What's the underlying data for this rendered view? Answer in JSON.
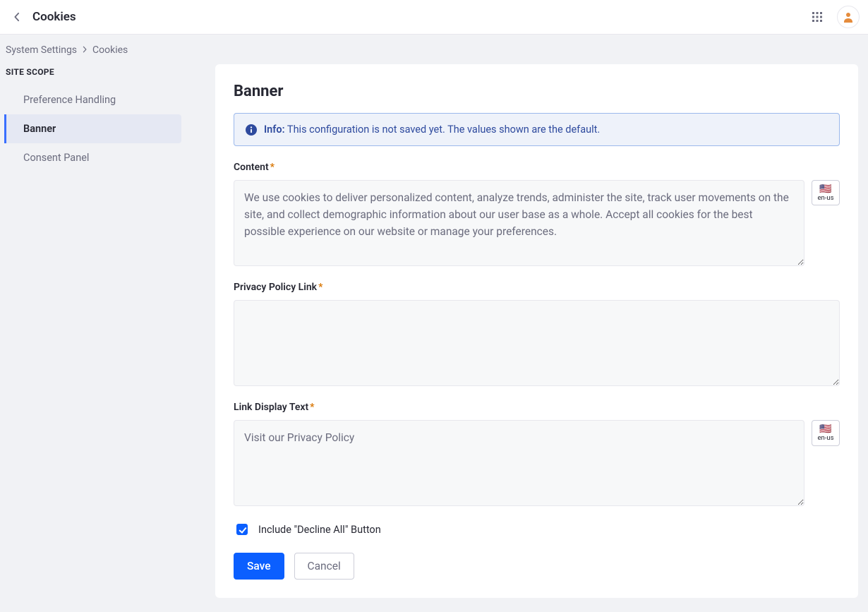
{
  "header": {
    "title": "Cookies"
  },
  "breadcrumb": {
    "items": [
      "System Settings",
      "Cookies"
    ]
  },
  "sidebar": {
    "scope_label": "SITE SCOPE",
    "items": [
      {
        "label": "Preference Handling",
        "active": false
      },
      {
        "label": "Banner",
        "active": true
      },
      {
        "label": "Consent Panel",
        "active": false
      }
    ]
  },
  "page": {
    "heading": "Banner",
    "alert": {
      "label": "Info:",
      "text": "This configuration is not saved yet. The values shown are the default."
    },
    "fields": {
      "content": {
        "label": "Content",
        "required": true,
        "value": "We use cookies to deliver personalized content, analyze trends, administer the site, track user movements on the site, and collect demographic information about our user base as a whole. Accept all cookies for the best possible experience on our website or manage your preferences.",
        "locale": {
          "flag": "🇺🇸",
          "code": "en-us"
        }
      },
      "privacy_link": {
        "label": "Privacy Policy Link",
        "required": true,
        "value": ""
      },
      "link_text": {
        "label": "Link Display Text",
        "required": true,
        "value": "Visit our Privacy Policy",
        "locale": {
          "flag": "🇺🇸",
          "code": "en-us"
        }
      },
      "decline_all": {
        "label": "Include \"Decline All\" Button",
        "checked": true
      }
    },
    "buttons": {
      "save": "Save",
      "cancel": "Cancel"
    }
  }
}
